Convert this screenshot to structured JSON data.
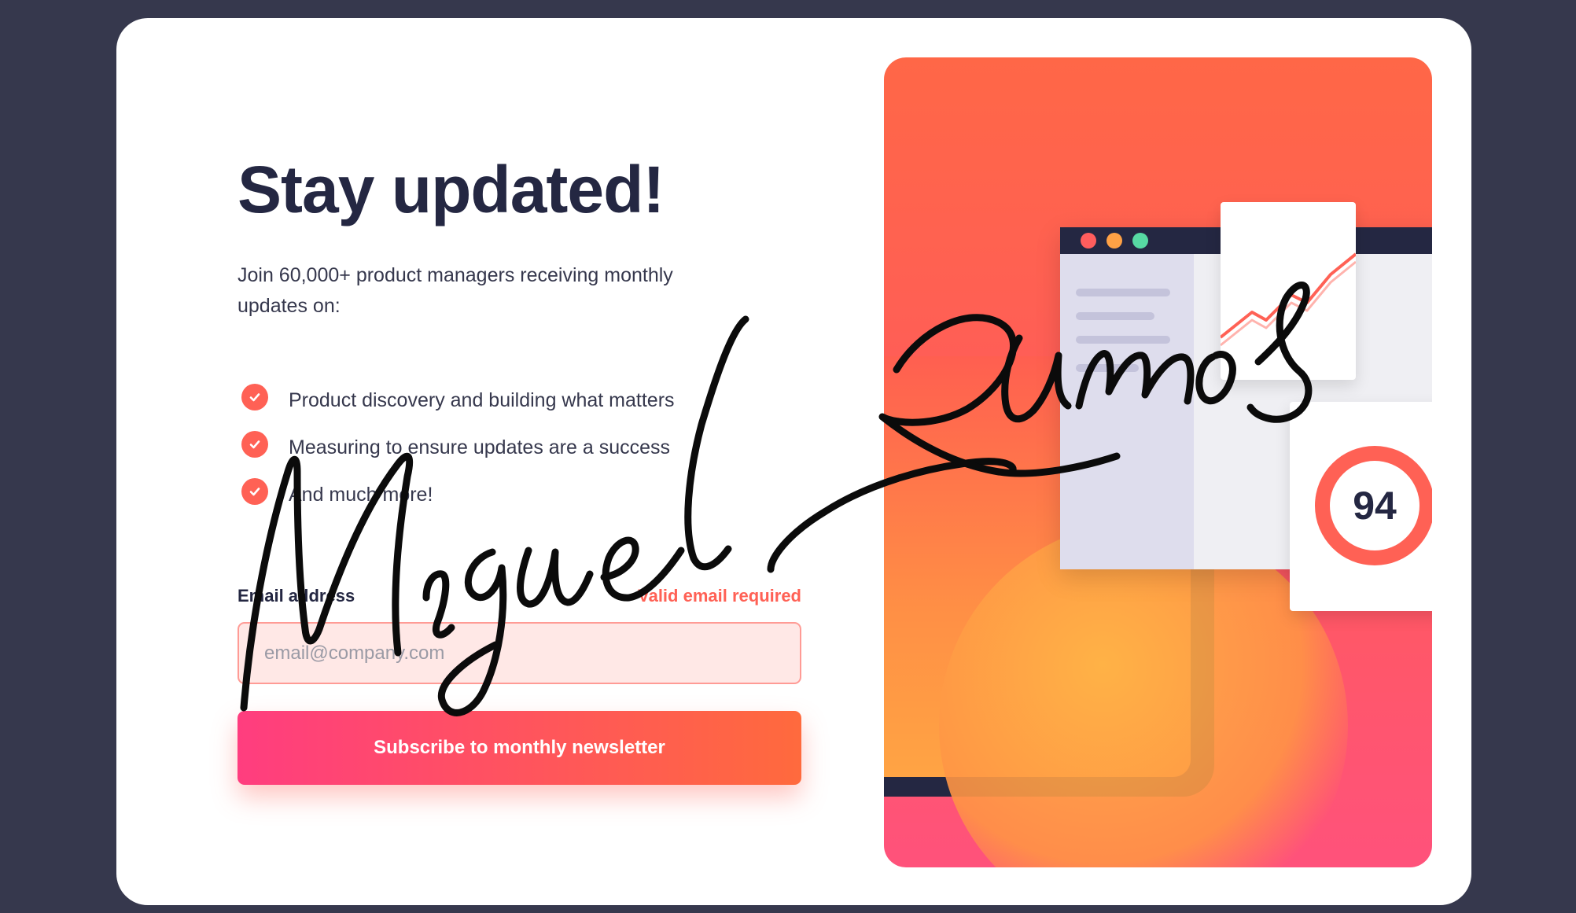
{
  "heading": "Stay updated!",
  "intro": "Join 60,000+ product managers receiving monthly updates on:",
  "features": [
    "Product discovery and building what matters",
    "Measuring to ensure updates are a success",
    "And much more!"
  ],
  "form": {
    "email_label": "Email address",
    "error_message": "Valid email required",
    "email_placeholder": "email@company.com",
    "email_value": "",
    "submit_label": "Subscribe to monthly newsletter"
  },
  "illustration": {
    "score": "94",
    "window_dot_colors": [
      "#ff5d5d",
      "#ffa145",
      "#57d9a3"
    ]
  },
  "signature_text": "Miguel Ramos",
  "colors": {
    "page_background": "#36384d",
    "accent": "#ff6155",
    "heading": "#242742",
    "gradient_start": "#ff3d7f",
    "gradient_end": "#ff6a3d"
  },
  "icons": {
    "check": "check-circle-icon"
  }
}
